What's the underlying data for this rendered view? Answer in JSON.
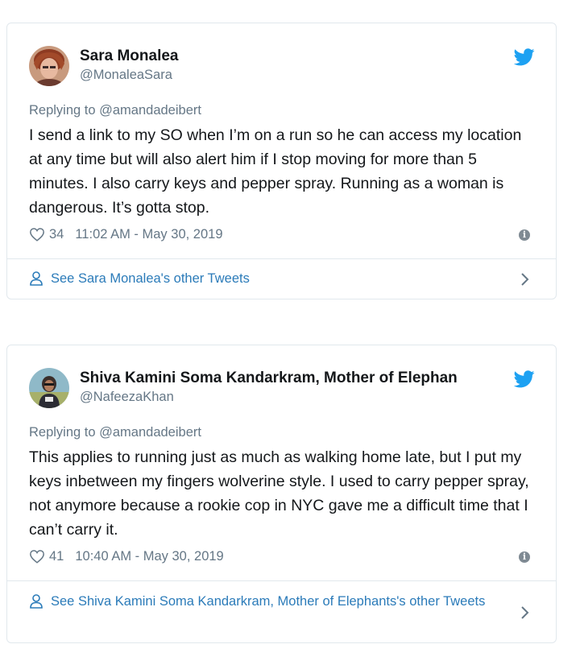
{
  "tweets": [
    {
      "name": "Sara Monalea",
      "handle": "@MonaleaSara",
      "replying": "Replying to @amandadeibert",
      "text": "I send a link to my SO when I’m on a run so he can access my location at any time but will also alert him if I stop moving for more than 5 minutes. I also carry keys and pepper spray. Running as a woman is dangerous. It’s gotta stop.",
      "likes": "34",
      "timestamp": "11:02 AM - May 30, 2019",
      "see_more": "See Sara Monalea's other Tweets",
      "icons": [
        "avatar",
        "twitter-bird-icon",
        "heart-icon",
        "info-icon",
        "person-icon",
        "chevron-right-icon"
      ]
    },
    {
      "name": "Shiva Kamini Soma Kandarkram, Mother of Elephan",
      "handle": "@NafeezaKhan",
      "replying": "Replying to @amandadeibert",
      "text": "This applies to running just as much as walking home late, but I put my keys inbetween my fingers wolverine style. I used to carry pepper spray, not anymore because a rookie cop in NYC gave me a difficult time that I can’t carry it.",
      "likes": "41",
      "timestamp": "10:40 AM - May 30, 2019",
      "see_more": "See Shiva Kamini Soma Kandarkram, Mother of Elephants's other Tweets",
      "icons": [
        "avatar",
        "twitter-bird-icon",
        "heart-icon",
        "info-icon",
        "person-icon",
        "chevron-right-icon"
      ]
    }
  ],
  "colors": {
    "twitter_blue": "#1da1f2",
    "link_blue": "#2b7bb9",
    "text": "#14171a",
    "muted": "#657786",
    "border": "#e1e8ed"
  }
}
